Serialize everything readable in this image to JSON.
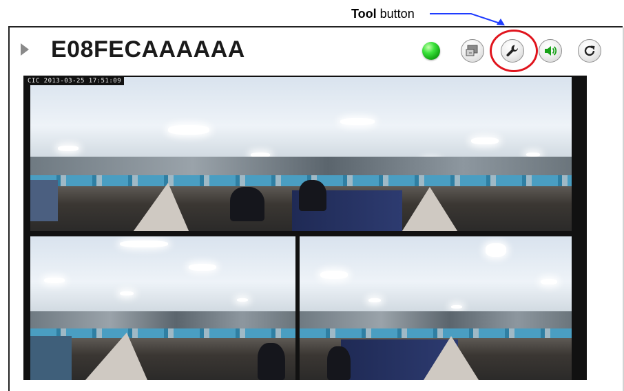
{
  "callout": {
    "bold": "Tool",
    "rest": " button"
  },
  "camera": {
    "title": "E08FECAAAAAA",
    "timestamp": "CIC 2013-03-25 17:51:09",
    "status_color": "#2fd12f"
  },
  "toolbar": {
    "buttons": [
      {
        "icon": "view-mode-icon"
      },
      {
        "icon": "wrench-icon",
        "highlighted": true
      },
      {
        "icon": "speaker-icon"
      },
      {
        "icon": "refresh-icon"
      }
    ]
  },
  "colors": {
    "highlight": "#e0141d",
    "callout_arrow": "#1f3cff"
  }
}
